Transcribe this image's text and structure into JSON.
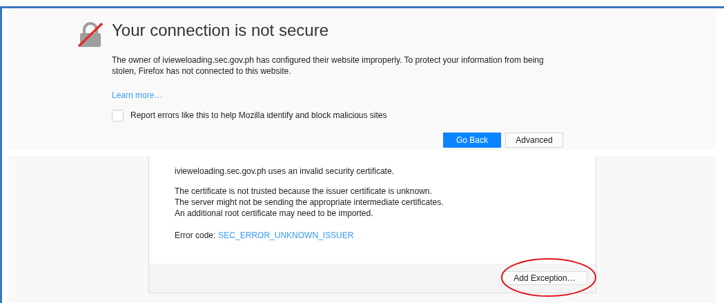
{
  "error_page": {
    "title": "Your connection is not secure",
    "description": "The owner of ivieweloading.sec.gov.ph has configured their website improperly. To protect your information from being stolen, Firefox has not connected to this website.",
    "learn_more": "Learn more…",
    "report_checkbox": {
      "label": "Report errors like this to help Mozilla identify and block malicious sites",
      "checked": false
    },
    "buttons": [
      {
        "label": "Go Back",
        "kind": "primary"
      },
      {
        "label": "Advanced",
        "kind": "secondary"
      }
    ]
  },
  "advanced_panel": {
    "paragraphs": [
      [
        "ivieweloading.sec.gov.ph uses an invalid security certificate."
      ],
      [
        "The certificate is not trusted because the issuer certificate is unknown.",
        "The server might not be sending the appropriate intermediate certificates.",
        "An additional root certificate may need to be imported."
      ]
    ],
    "error_code_label": "Error code:",
    "error_code": "SEC_ERROR_UNKNOWN_ISSUER",
    "button": {
      "label": "Add Exception…",
      "highlighted": true
    }
  }
}
